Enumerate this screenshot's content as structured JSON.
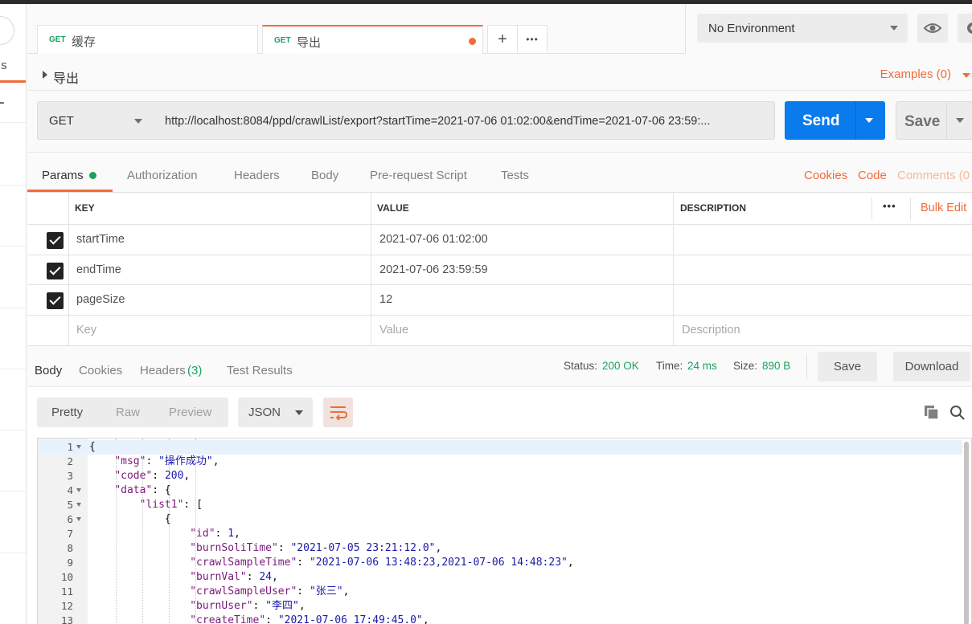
{
  "sidebar": {
    "fragment": "ıs",
    "plus": "+"
  },
  "tabs": [
    {
      "method": "GET",
      "title": "缓存",
      "active": false
    },
    {
      "method": "GET",
      "title": "导出",
      "active": true,
      "unsaved": true
    }
  ],
  "tabbar": {
    "add_symbol": "+",
    "more_symbol": "•••"
  },
  "environment": {
    "selected": "No Environment"
  },
  "request": {
    "name": "导出",
    "examples_label": "Examples (0)",
    "method": "GET",
    "url": "http://localhost:8084/ppd/crawlList/export?startTime=2021-07-06 01:02:00&endTime=2021-07-06 23:59:...",
    "send_label": "Send",
    "save_label": "Save"
  },
  "request_tabs": {
    "items": [
      "Params",
      "Authorization",
      "Headers",
      "Body",
      "Pre-request Script",
      "Tests"
    ],
    "active": "Params",
    "links": [
      "Cookies",
      "Code"
    ],
    "comments": "Comments (0"
  },
  "params": {
    "headers": {
      "key": "KEY",
      "value": "VALUE",
      "description": "DESCRIPTION",
      "more": "•••",
      "bulk_edit": "Bulk Edit"
    },
    "rows": [
      {
        "checked": true,
        "key": "startTime",
        "value": "2021-07-06 01:02:00",
        "description": ""
      },
      {
        "checked": true,
        "key": "endTime",
        "value": "2021-07-06 23:59:59",
        "description": ""
      },
      {
        "checked": true,
        "key": "pageSize",
        "value": "12",
        "description": ""
      }
    ],
    "placeholder": {
      "key": "Key",
      "value": "Value",
      "description": "Description"
    }
  },
  "response": {
    "tabs": [
      "Body",
      "Cookies",
      "Headers",
      "Test Results"
    ],
    "headers_count": "(3)",
    "status_label": "Status:",
    "status_value": "200 OK",
    "time_label": "Time:",
    "time_value": "24 ms",
    "size_label": "Size:",
    "size_value": "890 B",
    "save_label": "Save",
    "download_label": "Download"
  },
  "format": {
    "modes": [
      "Pretty",
      "Raw",
      "Preview"
    ],
    "active_mode": "Pretty",
    "language": "JSON"
  },
  "code_lines": [
    {
      "n": "1",
      "fold": true,
      "text": "{"
    },
    {
      "n": "2",
      "fold": false,
      "text": "    \"msg\": \"操作成功\","
    },
    {
      "n": "3",
      "fold": false,
      "text": "    \"code\": 200,"
    },
    {
      "n": "4",
      "fold": true,
      "text": "    \"data\": {"
    },
    {
      "n": "5",
      "fold": true,
      "text": "        \"list1\": ["
    },
    {
      "n": "6",
      "fold": true,
      "text": "            {"
    },
    {
      "n": "7",
      "fold": false,
      "text": "                \"id\": 1,"
    },
    {
      "n": "8",
      "fold": false,
      "text": "                \"burnSoliTime\": \"2021-07-05 23:21:12.0\","
    },
    {
      "n": "9",
      "fold": false,
      "text": "                \"crawlSampleTime\": \"2021-07-06 13:48:23,2021-07-06 14:48:23\","
    },
    {
      "n": "10",
      "fold": false,
      "text": "                \"burnVal\": 24,"
    },
    {
      "n": "11",
      "fold": false,
      "text": "                \"crawlSampleUser\": \"张三\","
    },
    {
      "n": "12",
      "fold": false,
      "text": "                \"burnUser\": \"李四\","
    },
    {
      "n": "13",
      "fold": false,
      "text": "                \"createTime\": \"2021-07-06 17:49:45.0\","
    }
  ],
  "colors": {
    "accent": "#f26b3a",
    "send": "#097bed",
    "success": "#1aa260",
    "get_method": "#1aa260"
  }
}
